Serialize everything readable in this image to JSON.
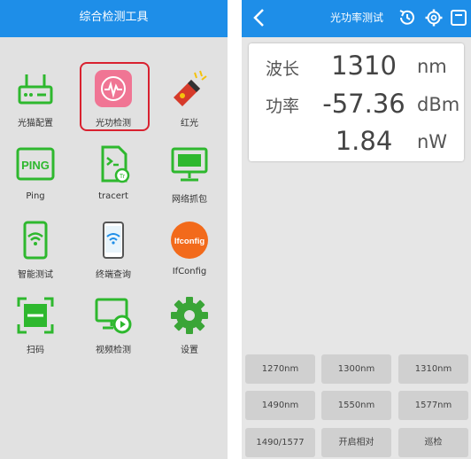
{
  "left": {
    "title": "综合检测工具",
    "tools": [
      {
        "label": "光猫配置",
        "icon": "router-icon"
      },
      {
        "label": "光功检测",
        "icon": "optical-power-icon"
      },
      {
        "label": "红光",
        "icon": "red-light-flashlight-icon"
      },
      {
        "label": "Ping",
        "icon": "ping-icon"
      },
      {
        "label": "tracert",
        "icon": "tracert-file-icon"
      },
      {
        "label": "网络抓包",
        "icon": "monitor-icon"
      },
      {
        "label": "智能测试",
        "icon": "wifi-phone-icon"
      },
      {
        "label": "终端查询",
        "icon": "terminal-phone-icon"
      },
      {
        "label": "IfConfig",
        "icon": "ifconfig-icon"
      },
      {
        "label": "扫码",
        "icon": "scan-icon"
      },
      {
        "label": "视频检测",
        "icon": "video-check-icon"
      },
      {
        "label": "设置",
        "icon": "gear-icon"
      }
    ],
    "ping_icon_text": "PING",
    "ifconfig_icon_text": "Ifconfig",
    "selected_index": 1
  },
  "right": {
    "title": "光功率测试",
    "readings": {
      "wavelength_label": "波长",
      "wavelength_value": "1310",
      "wavelength_unit": "nm",
      "power_label": "功率",
      "power_dbm": "-57.36",
      "power_dbm_unit": "dBm",
      "power_nw": "1.84",
      "power_nw_unit": "nW"
    },
    "buttons": [
      "1270nm",
      "1300nm",
      "1310nm",
      "1490nm",
      "1550nm",
      "1577nm",
      "1490/1577",
      "开启相对",
      "巡检"
    ]
  },
  "colors": {
    "topbar": "#1e8ee8",
    "icon_green": "#2eb82e",
    "highlight_red": "#d9212f",
    "pink": "#f07594",
    "orange": "#f26a1b"
  }
}
